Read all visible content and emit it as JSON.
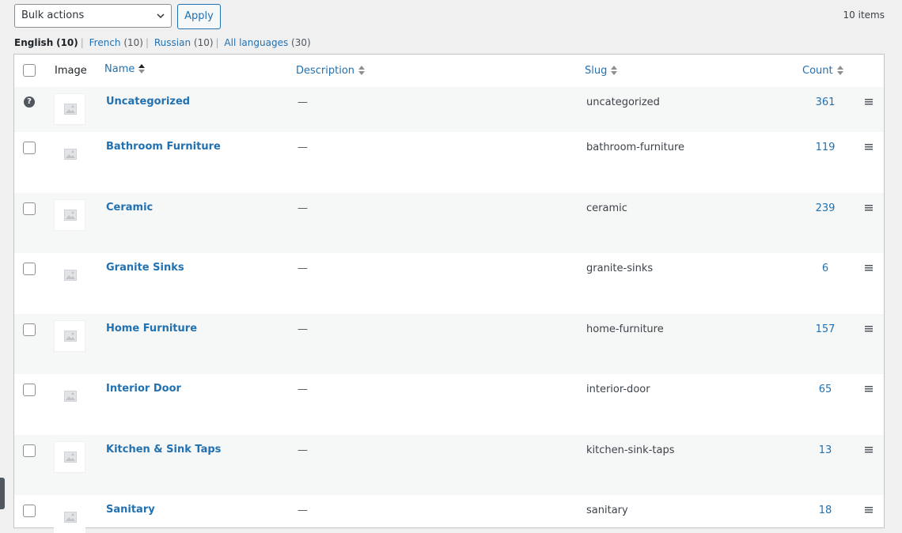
{
  "toolbar": {
    "bulk_actions": "Bulk actions",
    "apply": "Apply",
    "items_count": "10 items"
  },
  "languages": [
    {
      "label": "English",
      "count": "(10)",
      "current": true
    },
    {
      "label": "French",
      "count": "(10)",
      "current": false
    },
    {
      "label": "Russian",
      "count": "(10)",
      "current": false
    },
    {
      "label": "All languages",
      "count": "(30)",
      "current": false
    }
  ],
  "table": {
    "columns": {
      "image": "Image",
      "name": "Name",
      "description": "Description",
      "slug": "Slug",
      "count": "Count"
    },
    "rows": [
      {
        "name": "Uncategorized",
        "description": "—",
        "slug": "uncategorized",
        "count": "361"
      },
      {
        "name": "Bathroom Furniture",
        "description": "—",
        "slug": "bathroom-furniture",
        "count": "119"
      },
      {
        "name": "Ceramic",
        "description": "—",
        "slug": "ceramic",
        "count": "239"
      },
      {
        "name": "Granite Sinks",
        "description": "—",
        "slug": "granite-sinks",
        "count": "6"
      },
      {
        "name": "Home Furniture",
        "description": "—",
        "slug": "home-furniture",
        "count": "157"
      },
      {
        "name": "Interior Door",
        "description": "—",
        "slug": "interior-door",
        "count": "65"
      },
      {
        "name": "Kitchen & Sink Taps",
        "description": "—",
        "slug": "kitchen-sink-taps",
        "count": "13"
      },
      {
        "name": "Sanitary",
        "description": "—",
        "slug": "sanitary",
        "count": "18"
      }
    ]
  },
  "icons": {
    "default_category": "question-icon",
    "placeholder": "image-placeholder-icon",
    "drag": "drag-handle-icon",
    "sort": "sort-arrows-icon"
  },
  "colors": {
    "link": "#2271b1",
    "background": "#f0f0f1",
    "row_alt": "#f6f7f7"
  }
}
